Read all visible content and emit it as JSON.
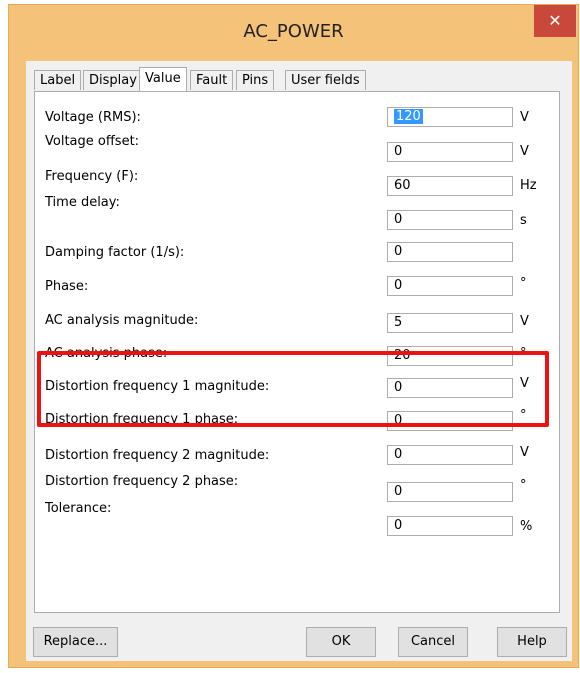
{
  "window": {
    "title": "AC_POWER",
    "close_glyph": "✕"
  },
  "tabs": [
    {
      "label": "Label"
    },
    {
      "label": "Display"
    },
    {
      "label": "Value"
    },
    {
      "label": "Fault"
    },
    {
      "label": "Pins"
    },
    {
      "label": "User fields"
    }
  ],
  "fields": [
    {
      "label": "Voltage (RMS):",
      "value": "120",
      "unit": "V"
    },
    {
      "label": "Voltage offset:",
      "value": "0",
      "unit": "V"
    },
    {
      "label": "Frequency (F):",
      "value": "60",
      "unit": "Hz"
    },
    {
      "label": "Time delay:",
      "value": "0",
      "unit": "s"
    },
    {
      "label": "Damping factor (1/s):",
      "value": "0",
      "unit": ""
    },
    {
      "label": "Phase:",
      "value": "0",
      "unit": "°"
    },
    {
      "label": "AC analysis magnitude:",
      "value": "5",
      "unit": "V"
    },
    {
      "label": "AC analysis phase:",
      "value": "20",
      "unit": "°"
    },
    {
      "label": "Distortion frequency 1 magnitude:",
      "value": "0",
      "unit": "V"
    },
    {
      "label": "Distortion frequency 1 phase:",
      "value": "0",
      "unit": "°"
    },
    {
      "label": "Distortion frequency 2 magnitude:",
      "value": "0",
      "unit": "V"
    },
    {
      "label": "Distortion frequency 2 phase:",
      "value": "0",
      "unit": "°"
    },
    {
      "label": "Tolerance:",
      "value": "0",
      "unit": "%"
    }
  ],
  "buttons": {
    "replace": "Replace...",
    "ok": "OK",
    "cancel": "Cancel",
    "help": "Help"
  }
}
